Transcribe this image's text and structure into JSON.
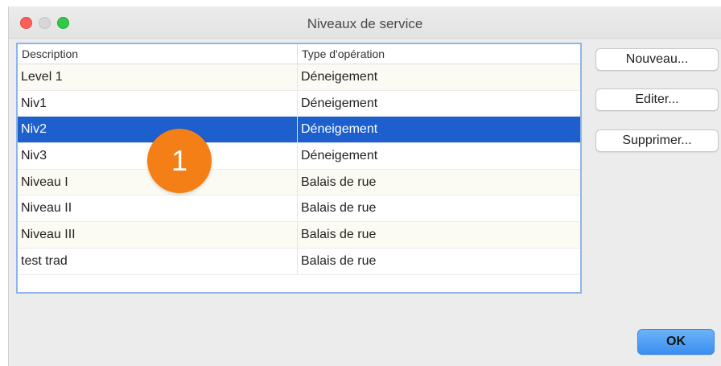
{
  "window": {
    "title": "Niveaux de service"
  },
  "table": {
    "columns": [
      "Description",
      "Type d'opération"
    ],
    "rows": [
      {
        "description": "Level 1",
        "type": "Déneigement"
      },
      {
        "description": "Niv1",
        "type": "Déneigement"
      },
      {
        "description": "Niv2",
        "type": "Déneigement",
        "selected": true
      },
      {
        "description": "Niv3",
        "type": "Déneigement"
      },
      {
        "description": "Niveau I",
        "type": "Balais de rue"
      },
      {
        "description": "Niveau II",
        "type": "Balais de rue"
      },
      {
        "description": "Niveau III",
        "type": "Balais de rue"
      },
      {
        "description": "test trad",
        "type": "Balais de rue"
      }
    ]
  },
  "buttons": {
    "new_label": "Nouveau...",
    "edit_label": "Editer...",
    "delete_label": "Supprimer...",
    "ok_label": "OK"
  },
  "annotation": {
    "badge_number": "1",
    "badge_color": "#f57f17"
  },
  "colors": {
    "selection": "#1c5fcd",
    "close": "#fc5f57",
    "zoom": "#34c84a"
  }
}
